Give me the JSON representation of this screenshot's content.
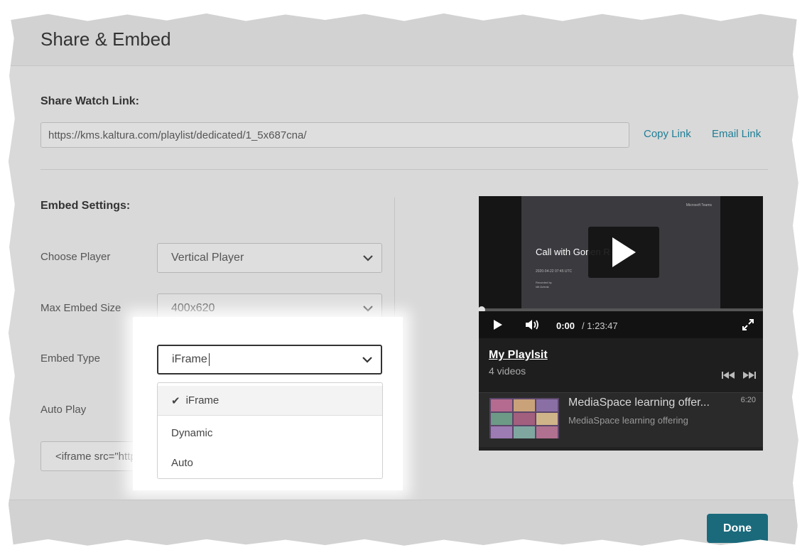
{
  "dialog": {
    "title": "Share & Embed"
  },
  "share": {
    "heading": "Share Watch Link:",
    "url": "https://kms.kaltura.com/playlist/dedicated/1_5x687cna/",
    "copy_link": "Copy Link",
    "email_link": "Email Link"
  },
  "embed": {
    "heading": "Embed Settings:",
    "choose_player_label": "Choose Player",
    "choose_player_value": "Vertical Player",
    "max_size_label": "Max Embed Size",
    "max_size_value": "400x620",
    "embed_type_label": "Embed Type",
    "embed_type_value": "iFrame",
    "auto_play_label": "Auto Play",
    "embed_type_options": [
      "iFrame",
      "Dynamic",
      "Auto"
    ],
    "selected_option_index": 0,
    "code_snippet": "<iframe src=\"https:/"
  },
  "player": {
    "slide_brand": "Microsoft Teams",
    "slide_title": "Call with Gonen R",
    "slide_date": "2020-04-22 07:45 UTC",
    "slide_by": "Recorded by",
    "slide_presenter": "Idit Achrak",
    "current_time": "0:00",
    "duration": "/ 1:23:47",
    "progress": 0,
    "playlist_name": "My Playlsit",
    "video_count": "4 videos",
    "item_title": "MediaSpace learning offer...",
    "item_subtitle": "MediaSpace learning offering",
    "item_duration": "6:20"
  },
  "footer": {
    "done_label": "Done"
  },
  "colors": {
    "accent": "#1a6a7c",
    "link": "#1f7e96",
    "player_bg": "#222222"
  },
  "icons": [
    "chevron-down-icon",
    "check-icon",
    "play-icon",
    "volume-icon",
    "fullscreen-icon",
    "prev-icon",
    "next-icon"
  ]
}
